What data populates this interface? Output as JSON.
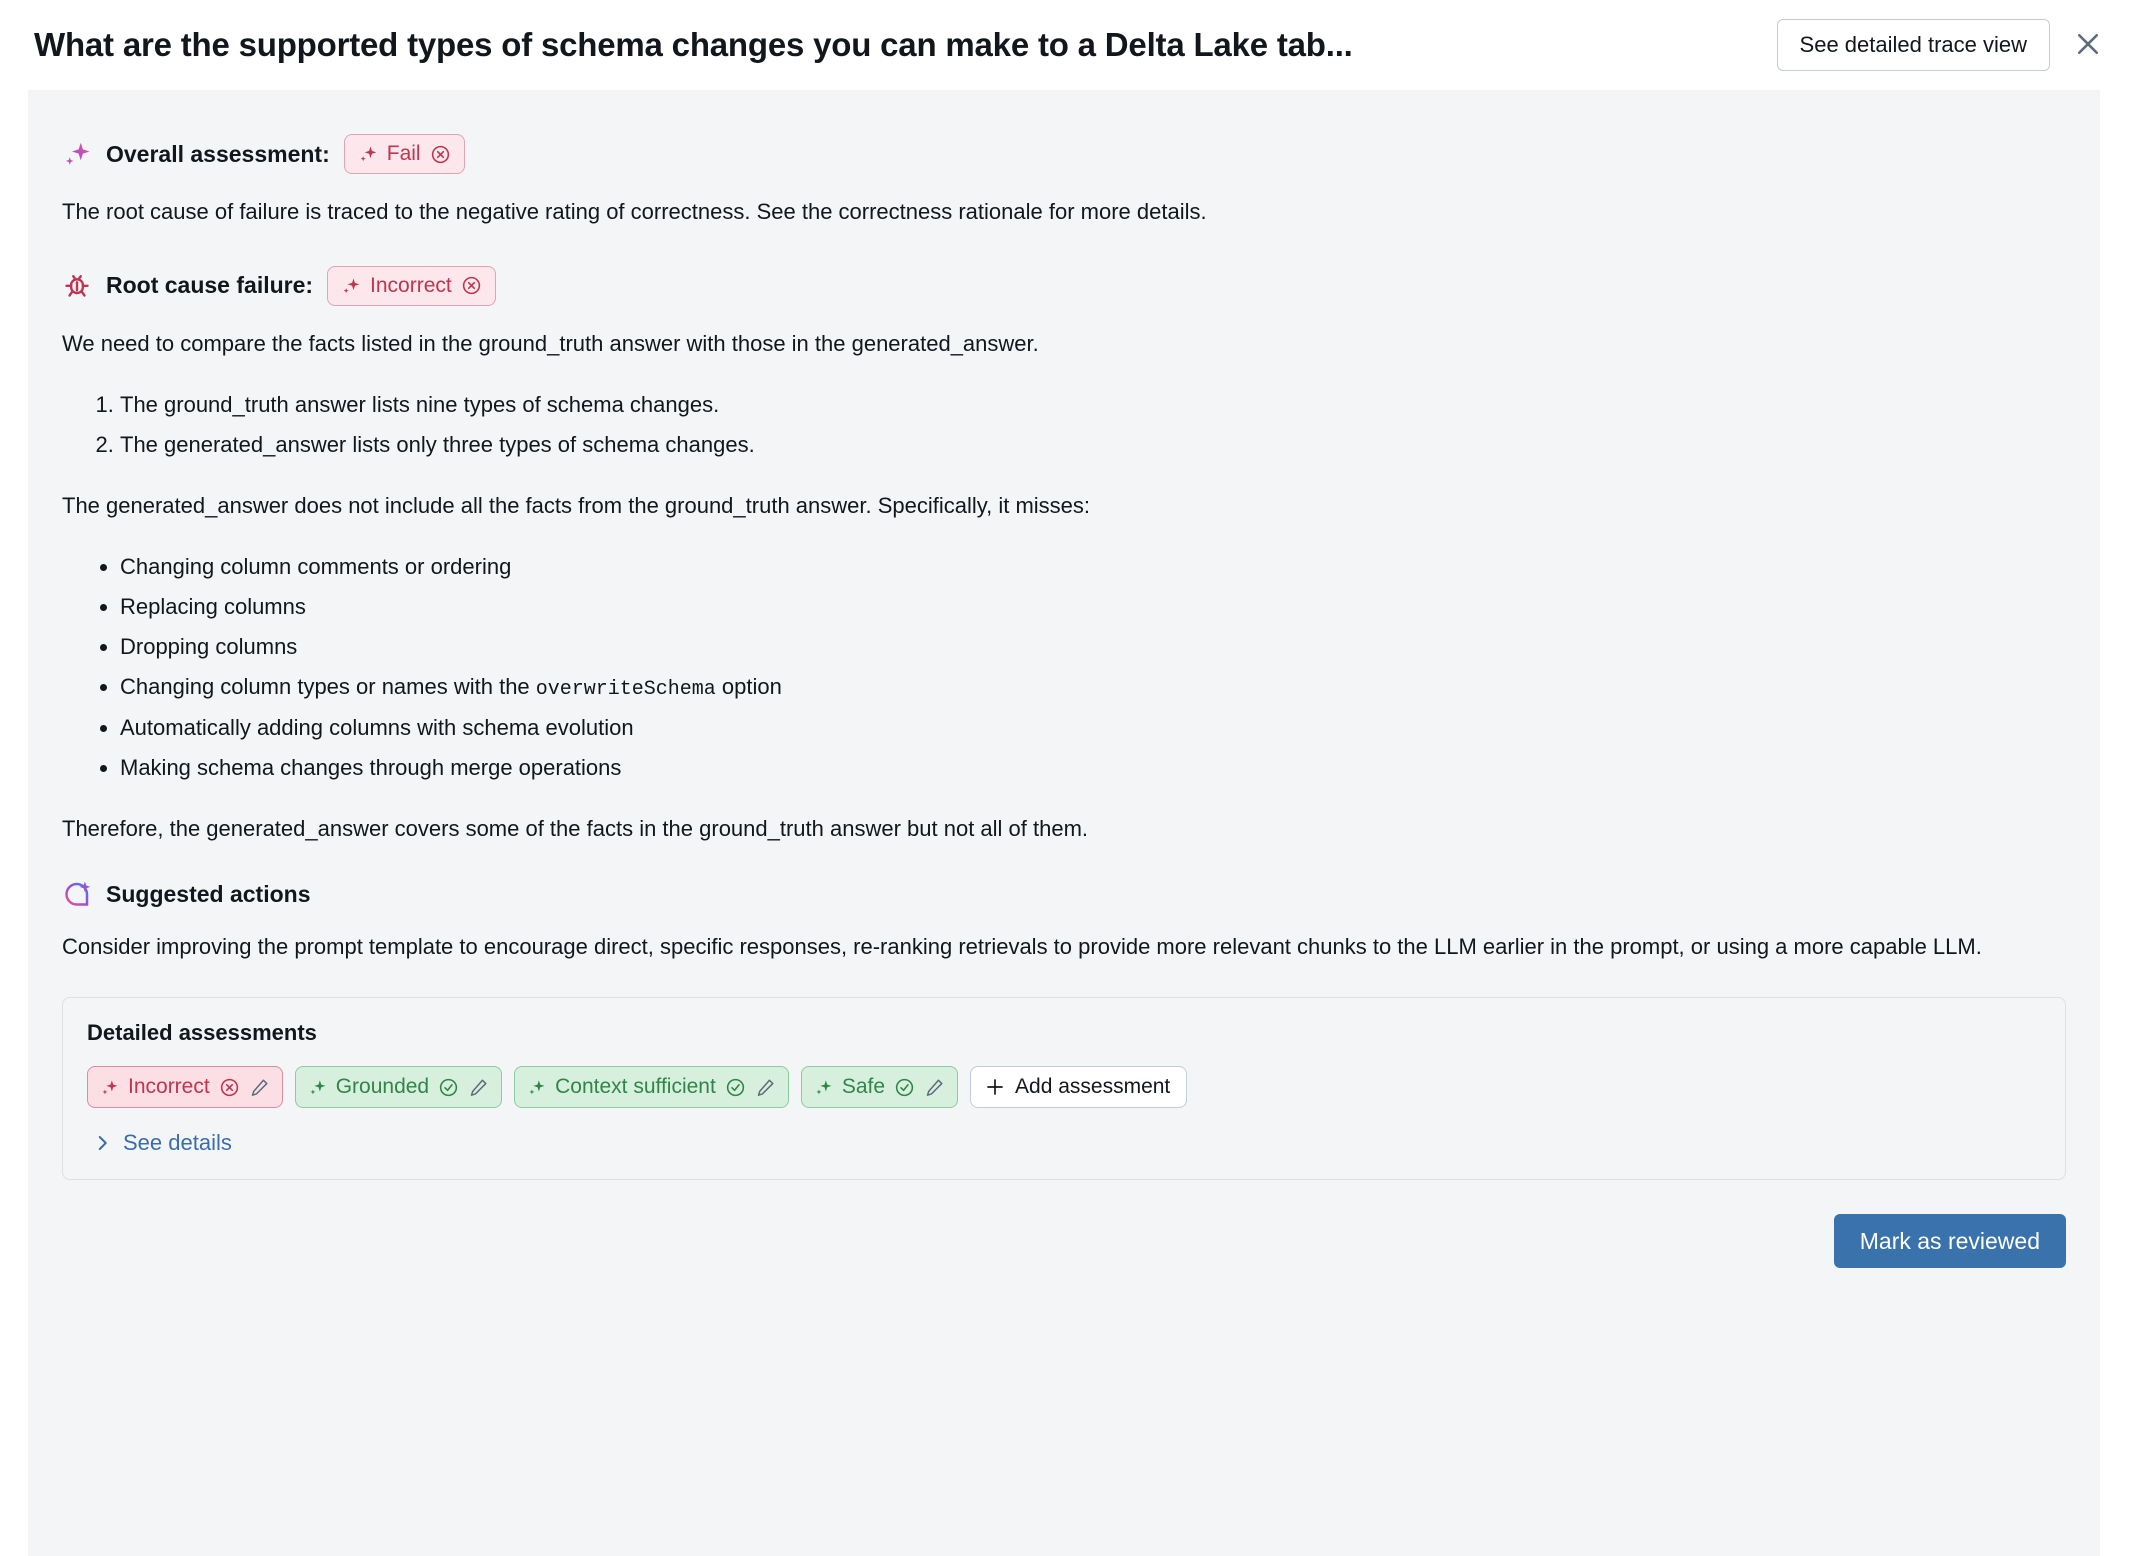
{
  "header": {
    "title": "What are the supported types of schema changes you can make to a Delta Lake tab...",
    "trace_button": "See detailed trace view",
    "close_icon": "close-icon"
  },
  "overall": {
    "icon": "sparkle-icon",
    "label": "Overall assessment:",
    "badge": {
      "text": "Fail",
      "sparkle_icon": "sparkle-icon",
      "status_icon": "x-circle-icon"
    },
    "description": "The root cause of failure is traced to the negative rating of correctness. See the correctness rationale for more details."
  },
  "root_cause": {
    "icon": "bug-icon",
    "label": "Root cause failure:",
    "badge": {
      "text": "Incorrect",
      "sparkle_icon": "sparkle-icon",
      "status_icon": "x-circle-icon"
    },
    "intro": "We need to compare the facts listed in the ground_truth answer with those in the generated_answer.",
    "numbered": [
      "The ground_truth answer lists nine types of schema changes.",
      "The generated_answer lists only three types of schema changes."
    ],
    "misses_intro": "The generated_answer does not include all the facts from the ground_truth answer. Specifically, it misses:",
    "misses": [
      {
        "pre": "Changing column comments or ordering",
        "code": "",
        "post": ""
      },
      {
        "pre": "Replacing columns",
        "code": "",
        "post": ""
      },
      {
        "pre": "Dropping columns",
        "code": "",
        "post": ""
      },
      {
        "pre": "Changing column types or names with the ",
        "code": "overwriteSchema",
        "post": " option"
      },
      {
        "pre": "Automatically adding columns with schema evolution",
        "code": "",
        "post": ""
      },
      {
        "pre": "Making schema changes through merge operations",
        "code": "",
        "post": ""
      }
    ],
    "conclusion": "Therefore, the generated_answer covers some of the facts in the ground_truth answer but not all of them."
  },
  "suggested": {
    "icon": "suggestion-bubble-icon",
    "label": "Suggested actions",
    "text": "Consider improving the prompt template to encourage direct, specific responses, re-ranking retrievals to provide more relevant chunks to the LLM earlier in the prompt, or using a more capable LLM."
  },
  "detailed": {
    "title": "Detailed assessments",
    "chips": [
      {
        "text": "Incorrect",
        "state": "fail",
        "status_icon": "x-circle-icon",
        "edit_icon": "pencil-icon"
      },
      {
        "text": "Grounded",
        "state": "ok",
        "status_icon": "check-circle-icon",
        "edit_icon": "pencil-icon"
      },
      {
        "text": "Context sufficient",
        "state": "ok",
        "status_icon": "check-circle-icon",
        "edit_icon": "pencil-icon"
      },
      {
        "text": "Safe",
        "state": "ok",
        "status_icon": "check-circle-icon",
        "edit_icon": "pencil-icon"
      }
    ],
    "add_label": "Add assessment",
    "add_icon": "plus-icon",
    "see_details": "See details",
    "see_details_icon": "chevron-right-icon"
  },
  "footer": {
    "primary_button": "Mark as reviewed"
  },
  "colors": {
    "fail": "#C0344F",
    "pass": "#308446",
    "link": "#3B6EA8",
    "primary": "#3A72AC",
    "card_bg": "#F4F5F7"
  }
}
